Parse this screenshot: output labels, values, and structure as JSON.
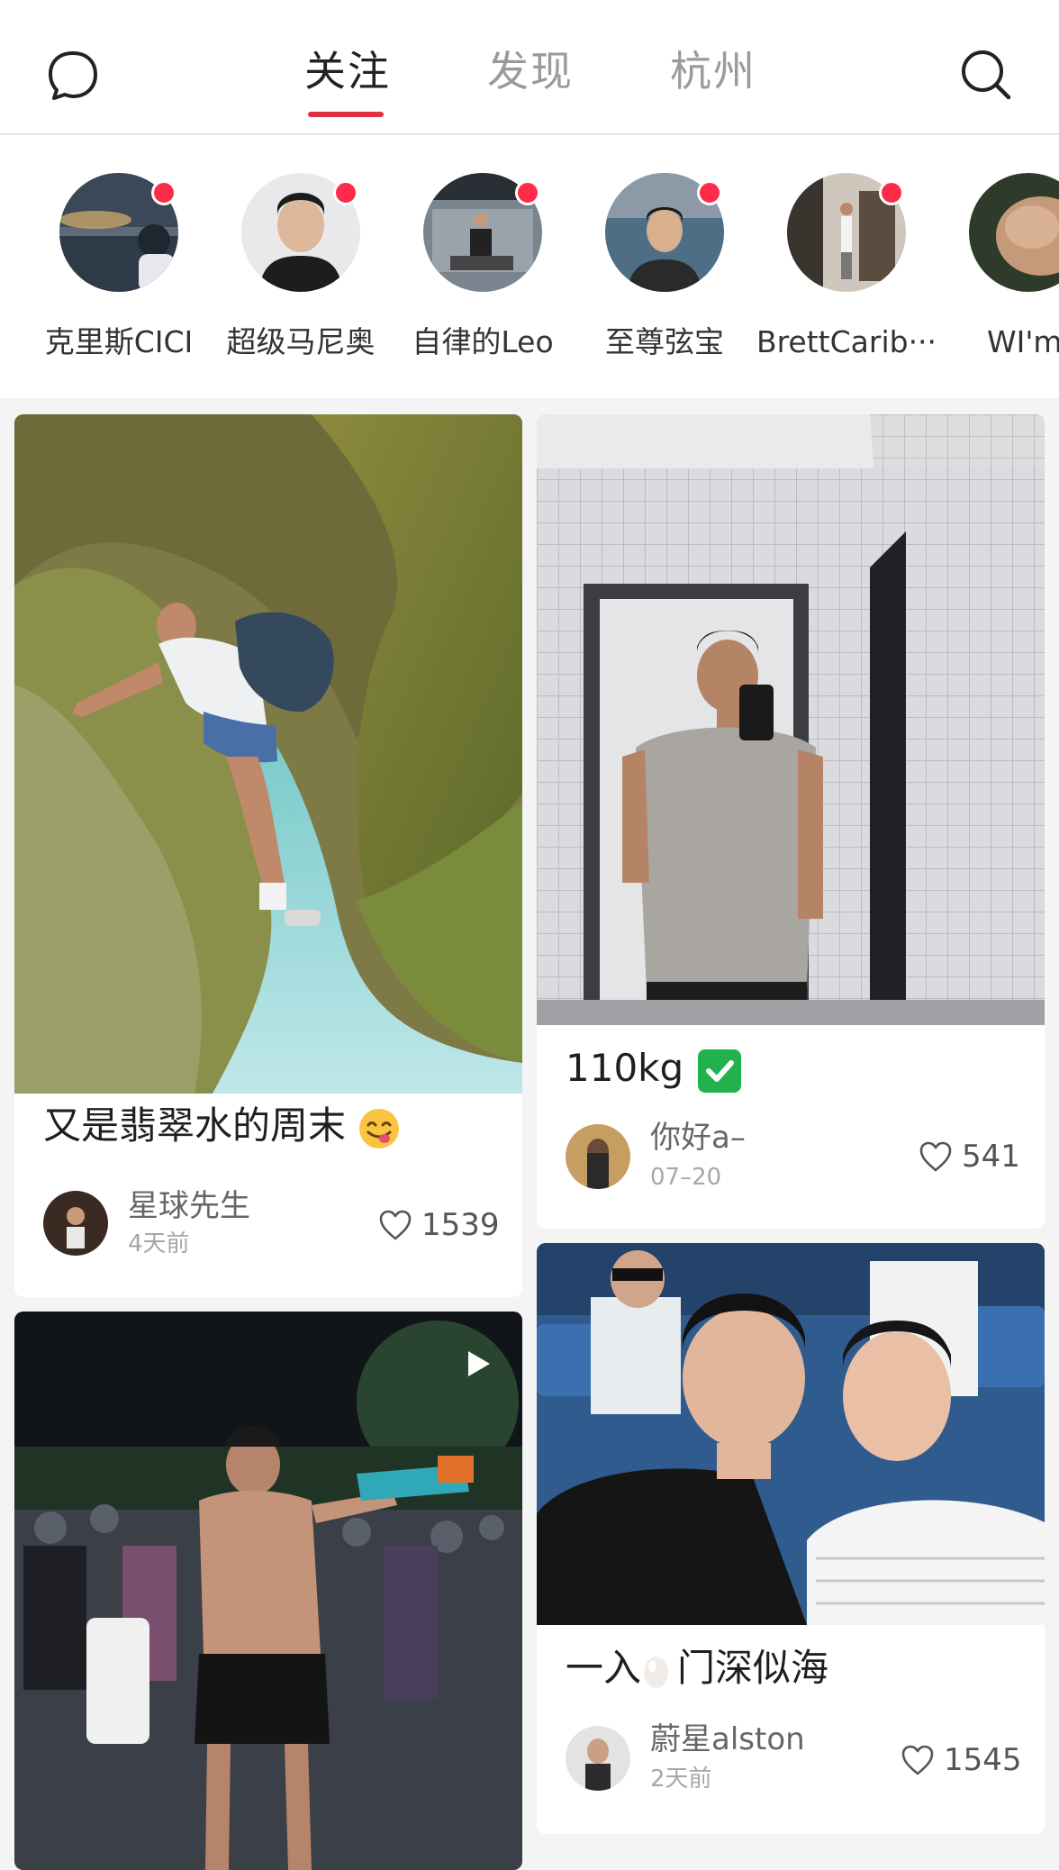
{
  "header": {
    "left_icon": "chat-bubble-icon",
    "right_icon": "search-icon",
    "tabs": [
      {
        "label": "关注",
        "active": true
      },
      {
        "label": "发现",
        "active": false
      },
      {
        "label": "杭州",
        "active": false
      }
    ],
    "accent_color": "#e02e45"
  },
  "stories": [
    {
      "name": "克里斯CICI",
      "has_update": true
    },
    {
      "name": "超级马尼奥",
      "has_update": true
    },
    {
      "name": "自律的Leo",
      "has_update": true
    },
    {
      "name": "至尊弦宝",
      "has_update": true
    },
    {
      "name": "BrettCarib···",
      "has_update": true
    },
    {
      "name": "WI'm",
      "has_update": false
    }
  ],
  "feed": {
    "left": [
      {
        "title": "又是翡翠水的周末",
        "title_emoji": "face-savoring-food-emoji",
        "author": "星球先生",
        "date": "4天前",
        "likes": "1539"
      },
      {
        "title": "",
        "author": "",
        "date": "",
        "likes": "",
        "video_icon": "play-icon"
      }
    ],
    "right": [
      {
        "title": "110kg",
        "title_emoji": "check-mark-button-emoji",
        "author": "你好a–",
        "date": "07–20",
        "likes": "541"
      },
      {
        "title_pre": "一入",
        "title_emoji": "egg-emoji",
        "title_post": "门深似海",
        "author": "蔚星alston",
        "date": "2天前",
        "likes": "1545"
      }
    ]
  }
}
